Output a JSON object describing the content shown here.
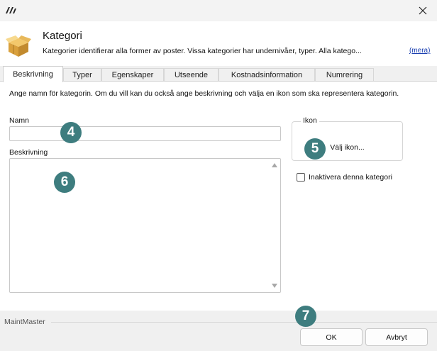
{
  "window": {
    "close_icon": "close-icon",
    "logo_icon": "app-logo-icon"
  },
  "header": {
    "title": "Kategori",
    "description": "Kategorier identifierar alla former av poster. Vissa kategorier har undernivåer, typer. Alla katego...",
    "more_link": "(mera)",
    "icon": "box-icon"
  },
  "tabs": [
    {
      "label": "Beskrivning",
      "active": true
    },
    {
      "label": "Typer"
    },
    {
      "label": "Egenskaper"
    },
    {
      "label": "Utseende"
    },
    {
      "label": "Kostnadsinformation"
    },
    {
      "label": "Numrering"
    }
  ],
  "form": {
    "instruction": "Ange namn för kategorin. Om du vill kan du också ange beskrivning och välja en ikon som ska representera kategorin.",
    "name_label": "Namn",
    "name_value": "",
    "description_label": "Beskrivning",
    "description_value": "",
    "icon_group_label": "Ikon",
    "choose_icon_button": "Välj ikon...",
    "inactivate_label": "Inaktivera denna kategori",
    "inactivate_checked": false
  },
  "callouts": [
    "4",
    "5",
    "6",
    "7"
  ],
  "footer": {
    "brand": "MaintMaster",
    "ok_label": "OK",
    "cancel_label": "Avbryt"
  },
  "colors": {
    "callout": "#3e7d7f",
    "link": "#1a3fb0"
  }
}
